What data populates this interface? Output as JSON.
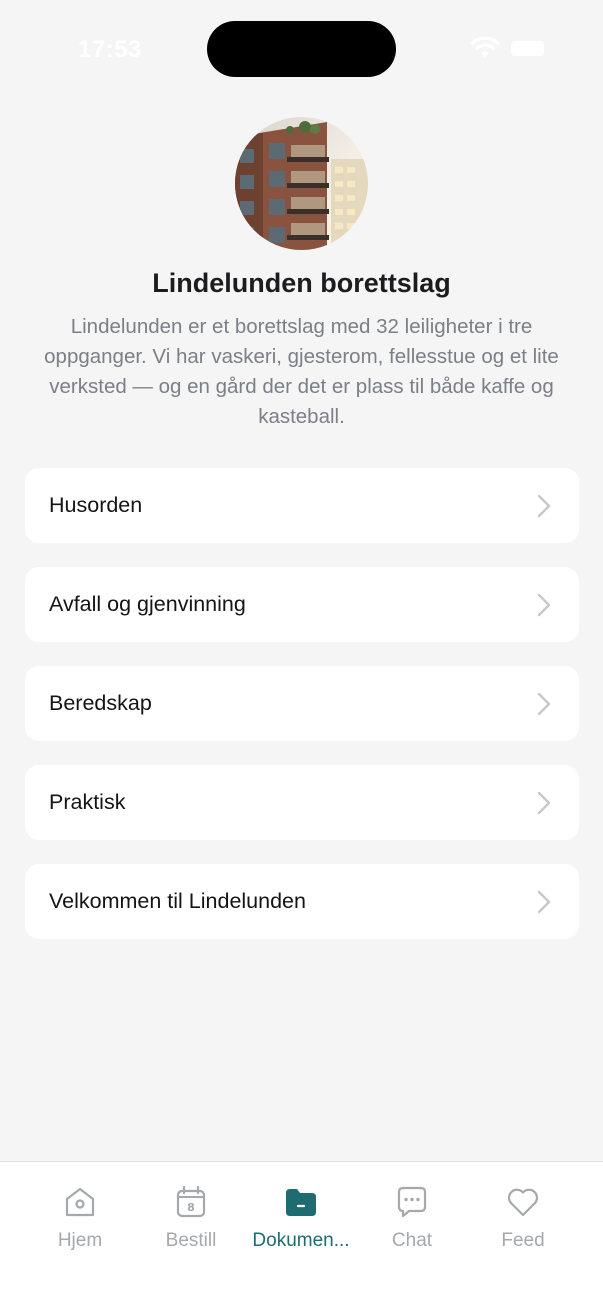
{
  "status_bar": {
    "time": "17:53"
  },
  "organization": {
    "name": "Lindelunden borettslag",
    "description": "Lindelunden er et borettslag med 32 leiligheter i tre oppganger. Vi har vaskeri, gjesterom, fellesstue og et lite verksted — og en gård der det er plass til både kaffe og kasteball."
  },
  "documents": [
    {
      "label": "Husorden"
    },
    {
      "label": "Avfall og gjenvinning"
    },
    {
      "label": "Beredskap"
    },
    {
      "label": "Praktisk"
    },
    {
      "label": "Velkommen til Lindelunden"
    }
  ],
  "tab_bar": {
    "active_color": "#1e6c72",
    "inactive_color": "#a5a8ad",
    "tabs": [
      {
        "label": "Hjem",
        "icon": "home-icon",
        "active": false
      },
      {
        "label": "Bestill",
        "icon": "calendar-icon",
        "badge": "8",
        "active": false
      },
      {
        "label": "Dokumen...",
        "icon": "folder-icon",
        "active": true
      },
      {
        "label": "Chat",
        "icon": "chat-icon",
        "active": false
      },
      {
        "label": "Feed",
        "icon": "heart-icon",
        "active": false
      }
    ]
  }
}
